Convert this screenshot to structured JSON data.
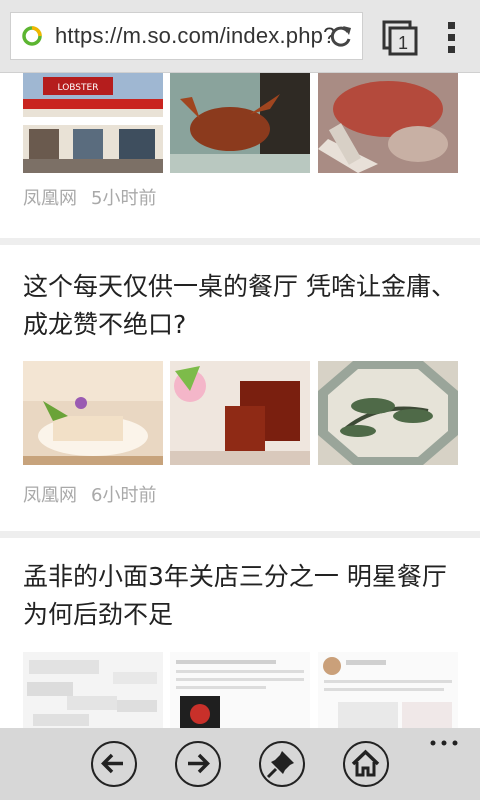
{
  "browser": {
    "url": "https://m.so.com/index.php?",
    "tab_count": "1",
    "icons": [
      "so-logo-icon",
      "reload-icon",
      "tabs-icon",
      "overflow-menu-icon"
    ]
  },
  "articles": [
    {
      "title": "",
      "source": "凤凰网",
      "time": "5小时前",
      "images": [
        "lobster-restaurant-storefront",
        "lobster-in-water",
        "lobster-being-cut"
      ]
    },
    {
      "title": "这个每天仅供一桌的餐厅 凭啥让金庸、成龙赞不绝口?",
      "source": "凤凰网",
      "time": "6小时前",
      "images": [
        "dessert-with-flowers",
        "red-bean-jelly",
        "pine-painting-window"
      ]
    },
    {
      "title": "孟非的小面3年关店三分之一 明星餐厅为何后劲不足",
      "source": "",
      "time": "",
      "images": [
        "weibo-screenshot-1",
        "weibo-screenshot-2",
        "weibo-screenshot-3"
      ]
    }
  ],
  "bottom_bar": {
    "buttons": [
      "back-icon",
      "forward-icon",
      "pin-icon",
      "home-icon"
    ],
    "more": "overflow-dots-icon"
  },
  "colors": {
    "topbar": "#e6e6e6",
    "bottombar": "#d7d7d7",
    "meta": "#a9a9a9",
    "separator": "#eeeeee"
  }
}
